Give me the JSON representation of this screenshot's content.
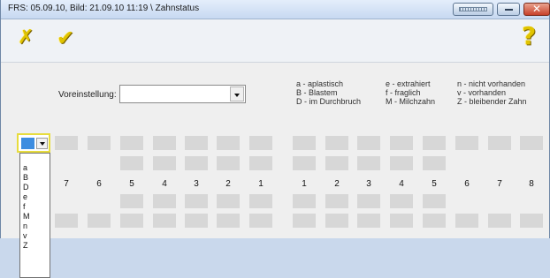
{
  "window": {
    "title": "FRS: 05.09.10,  Bild: 21.09.10  11:19 \\ Zahnstatus",
    "close_glyph": "✕"
  },
  "toolbar": {
    "cancel_icon": "✗",
    "ok_icon": "✔",
    "help_icon": "?"
  },
  "preset": {
    "label": "Voreinstellung:",
    "value": ""
  },
  "legend": {
    "col1": [
      "a - aplastisch",
      "B - Blastem",
      "D - im Durchbruch"
    ],
    "col2": [
      "e  - extrahiert",
      "f  - fraglich",
      "M - Milchzahn"
    ],
    "col3": [
      "n - nicht vorhanden",
      "v - vorhanden",
      "Z - bleibender Zahn"
    ]
  },
  "teeth": {
    "left_numbers": [
      "7",
      "6",
      "5",
      "4",
      "3",
      "2",
      "1"
    ],
    "right_numbers": [
      "1",
      "2",
      "3",
      "4",
      "5",
      "6",
      "7",
      "8"
    ]
  },
  "dropdown": {
    "options": [
      "a",
      "B",
      "D",
      "e",
      "f",
      "M",
      "n",
      "v",
      "Z"
    ]
  },
  "colors": {
    "selection_border": "#e7dc3e",
    "selection_fill": "#3d8de0",
    "cell": "#d7d7d7",
    "icon_yellow": "#e1c400"
  }
}
